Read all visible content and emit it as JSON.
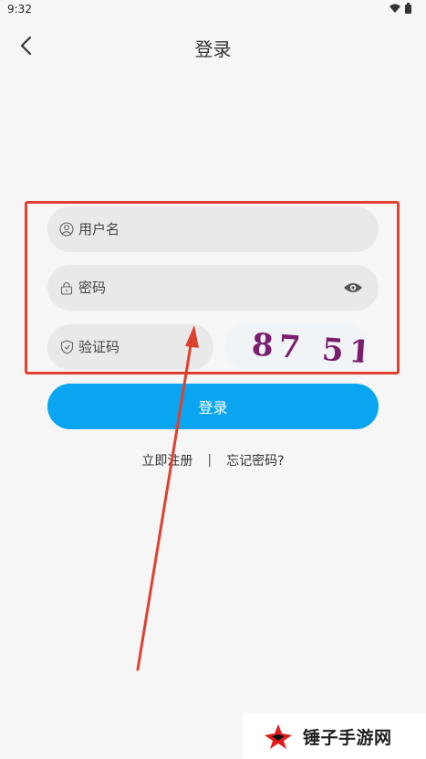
{
  "status_bar": {
    "time": "9:32"
  },
  "nav": {
    "title": "登录"
  },
  "form": {
    "username_placeholder": "用户名",
    "password_placeholder": "密码",
    "captcha_placeholder": "验证码",
    "captcha_code": "87 51"
  },
  "actions": {
    "login_label": "登录",
    "register_label": "立即注册",
    "separator": "|",
    "forgot_label": "忘记密码?"
  },
  "watermark": {
    "text": "锤子手游网"
  },
  "colors": {
    "primary": "#0aa5f0",
    "annotation": "#e0402e",
    "captcha_text": "#7a1f6e",
    "field_bg": "#e9e9e9"
  }
}
